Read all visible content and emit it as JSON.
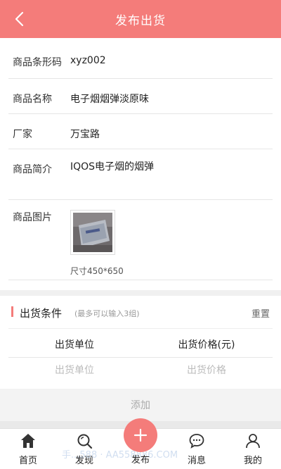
{
  "header": {
    "title": "发布出货",
    "back_icon": "chevron-left-icon"
  },
  "form": {
    "barcode": {
      "label": "商品条形码",
      "value": "xyz002"
    },
    "name": {
      "label": "商品名称",
      "value": "电子烟烟弹淡原味"
    },
    "manufacturer": {
      "label": "厂家",
      "value": "万宝路"
    },
    "description": {
      "label": "商品简介",
      "value": "IQOS电子烟的烟弹"
    },
    "image": {
      "label": "商品图片",
      "size_text": "尺寸450*650"
    }
  },
  "conditions": {
    "title": "出货条件",
    "hint": "(最多可以输入3组)",
    "reset_label": "重置",
    "columns": [
      "出货单位",
      "出货价格(元)"
    ],
    "unit_placeholder": "出货单位",
    "price_placeholder": "出货价格",
    "add_label": "添加"
  },
  "tabbar": {
    "items": [
      {
        "label": "首页",
        "icon": "home-icon"
      },
      {
        "label": "发现",
        "icon": "search-icon"
      },
      {
        "label": "发布",
        "icon": "plus-icon"
      },
      {
        "label": "消息",
        "icon": "chat-icon"
      },
      {
        "label": "我的",
        "icon": "user-icon"
      }
    ]
  },
  "watermark": "手...588 · AA558886.COM",
  "colors": {
    "accent": "#f47c7a",
    "divider": "#e6e6e6"
  }
}
